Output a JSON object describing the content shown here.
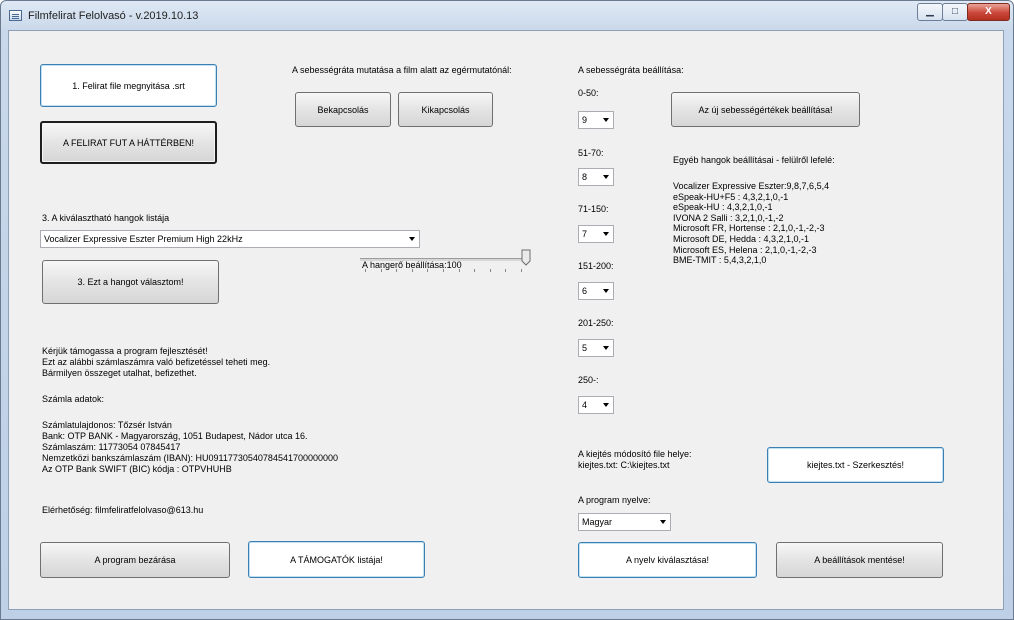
{
  "window": {
    "title": "Filmfelirat Felolvasó - v.2019.10.13",
    "controls": {
      "minimize": "▁",
      "maximize": "□",
      "close": "X"
    }
  },
  "file": {
    "open_button": "1.  Felirat file megnyitása .srt",
    "background_button": "A FELIRAT FUT A HÁTTÉRBEN!"
  },
  "speed_display": {
    "label": "A sebességráta mutatása a film alatt az egérmutatónál:",
    "on_button": "Bekapcsolás",
    "off_button": "Kikapcsolás"
  },
  "voices": {
    "list_label": "3.  A kiválasztható hangok listája",
    "selected": "Vocalizer Expressive Eszter Premium High 22kHz",
    "choose_button": "3. Ezt a hangot választom!"
  },
  "volume": {
    "label": "A hangerő beállítása:100",
    "value": 100,
    "max": 100
  },
  "support": {
    "lines": [
      "Kérjük támogassa a program fejlesztését!",
      "Ezt az alábbi számlaszámra való befizetéssel teheti meg.",
      "Bármilyen összeget utalhat, befizethet."
    ],
    "account_title": "Számla adatok:",
    "account_lines": [
      "Számlatulajdonos: Tőzsér István",
      "Bank: OTP BANK - Magyarország, 1051 Budapest, Nádor utca 16.",
      "Számlaszám: 11773054 07845417",
      "Nemzetközi bankszámlaszám (IBAN): HU09117730540784541700000000",
      "Az OTP Bank SWIFT (BIC) kódja : OTPVHUHB"
    ],
    "contact": "Elérhetőség: filmfeliratfelolvaso@613.hu"
  },
  "rates": {
    "title": "A sebességráta beállítása:",
    "groups": [
      {
        "range": "0-50:",
        "value": "9"
      },
      {
        "range": "51-70:",
        "value": "8"
      },
      {
        "range": "71-150:",
        "value": "7"
      },
      {
        "range": "151-200:",
        "value": "6"
      },
      {
        "range": "201-250:",
        "value": "5"
      },
      {
        "range": "250-:",
        "value": "4"
      }
    ],
    "apply_button": "Az új sebességértékek beállítása!",
    "other_title": "Egyéb hangok beállításai - felülről lefelé:",
    "other_lines": [
      "Vocalizer Expressive Eszter:9,8,7,6,5,4",
      "eSpeak-HU+F5 : 4,3,2,1,0,-1",
      "eSpeak-HU : 4,3,2,1,0,-1",
      "IVONA 2 Salli : 3,2,1,0,-1,-2",
      "Microsoft FR, Hortense : 2,1,0,-1,-2,-3",
      "Microsoft DE, Hedda : 4,3,2,1,0,-1",
      "Microsoft ES, Helena : 2,1,0,-1,-2,-3",
      "BME-TMIT : 5,4,3,2,1,0"
    ]
  },
  "pronunciation": {
    "label": "A kiejtés módosító file helye:",
    "path": "kiejtes.txt: C:\\kiejtes.txt",
    "edit_button": "kiejtes.txt - Szerkesztés!"
  },
  "language": {
    "label": "A program nyelve:",
    "selected": "Magyar",
    "select_button": "A nyelv kiválasztása!",
    "save_button": "A beállítások mentése!"
  },
  "footer": {
    "close_button": "A program bezárása",
    "supporters_button": "A TÁMOGATÓK listája!"
  }
}
